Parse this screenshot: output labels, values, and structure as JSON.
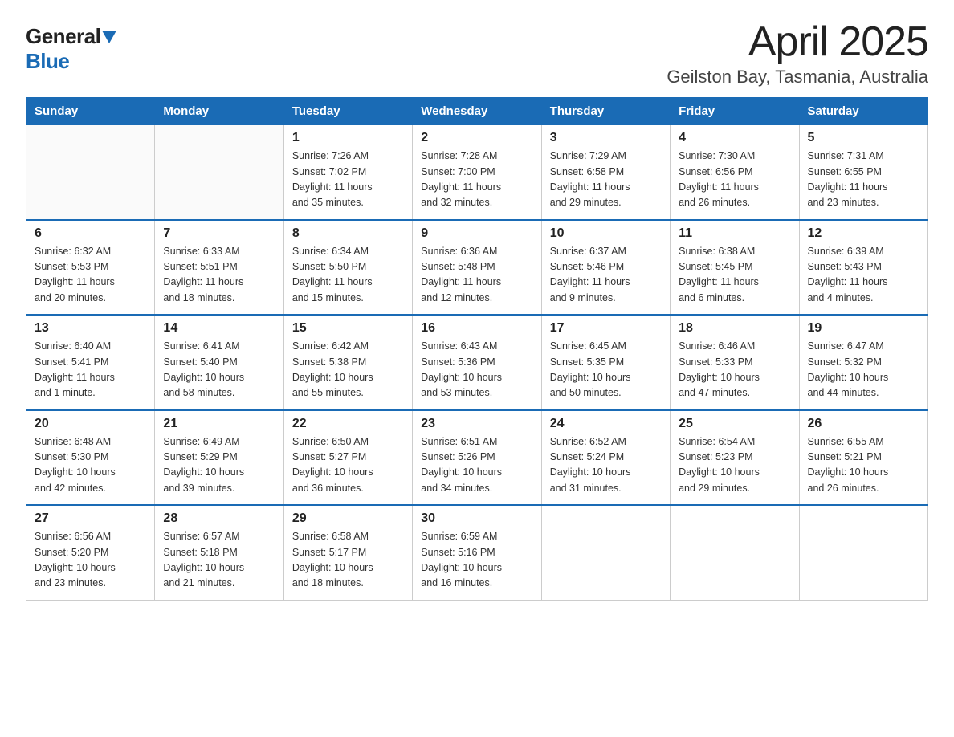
{
  "logo": {
    "general": "General",
    "blue": "Blue"
  },
  "title": "April 2025",
  "subtitle": "Geilston Bay, Tasmania, Australia",
  "weekdays": [
    "Sunday",
    "Monday",
    "Tuesday",
    "Wednesday",
    "Thursday",
    "Friday",
    "Saturday"
  ],
  "weeks": [
    [
      {
        "day": "",
        "info": ""
      },
      {
        "day": "",
        "info": ""
      },
      {
        "day": "1",
        "info": "Sunrise: 7:26 AM\nSunset: 7:02 PM\nDaylight: 11 hours\nand 35 minutes."
      },
      {
        "day": "2",
        "info": "Sunrise: 7:28 AM\nSunset: 7:00 PM\nDaylight: 11 hours\nand 32 minutes."
      },
      {
        "day": "3",
        "info": "Sunrise: 7:29 AM\nSunset: 6:58 PM\nDaylight: 11 hours\nand 29 minutes."
      },
      {
        "day": "4",
        "info": "Sunrise: 7:30 AM\nSunset: 6:56 PM\nDaylight: 11 hours\nand 26 minutes."
      },
      {
        "day": "5",
        "info": "Sunrise: 7:31 AM\nSunset: 6:55 PM\nDaylight: 11 hours\nand 23 minutes."
      }
    ],
    [
      {
        "day": "6",
        "info": "Sunrise: 6:32 AM\nSunset: 5:53 PM\nDaylight: 11 hours\nand 20 minutes."
      },
      {
        "day": "7",
        "info": "Sunrise: 6:33 AM\nSunset: 5:51 PM\nDaylight: 11 hours\nand 18 minutes."
      },
      {
        "day": "8",
        "info": "Sunrise: 6:34 AM\nSunset: 5:50 PM\nDaylight: 11 hours\nand 15 minutes."
      },
      {
        "day": "9",
        "info": "Sunrise: 6:36 AM\nSunset: 5:48 PM\nDaylight: 11 hours\nand 12 minutes."
      },
      {
        "day": "10",
        "info": "Sunrise: 6:37 AM\nSunset: 5:46 PM\nDaylight: 11 hours\nand 9 minutes."
      },
      {
        "day": "11",
        "info": "Sunrise: 6:38 AM\nSunset: 5:45 PM\nDaylight: 11 hours\nand 6 minutes."
      },
      {
        "day": "12",
        "info": "Sunrise: 6:39 AM\nSunset: 5:43 PM\nDaylight: 11 hours\nand 4 minutes."
      }
    ],
    [
      {
        "day": "13",
        "info": "Sunrise: 6:40 AM\nSunset: 5:41 PM\nDaylight: 11 hours\nand 1 minute."
      },
      {
        "day": "14",
        "info": "Sunrise: 6:41 AM\nSunset: 5:40 PM\nDaylight: 10 hours\nand 58 minutes."
      },
      {
        "day": "15",
        "info": "Sunrise: 6:42 AM\nSunset: 5:38 PM\nDaylight: 10 hours\nand 55 minutes."
      },
      {
        "day": "16",
        "info": "Sunrise: 6:43 AM\nSunset: 5:36 PM\nDaylight: 10 hours\nand 53 minutes."
      },
      {
        "day": "17",
        "info": "Sunrise: 6:45 AM\nSunset: 5:35 PM\nDaylight: 10 hours\nand 50 minutes."
      },
      {
        "day": "18",
        "info": "Sunrise: 6:46 AM\nSunset: 5:33 PM\nDaylight: 10 hours\nand 47 minutes."
      },
      {
        "day": "19",
        "info": "Sunrise: 6:47 AM\nSunset: 5:32 PM\nDaylight: 10 hours\nand 44 minutes."
      }
    ],
    [
      {
        "day": "20",
        "info": "Sunrise: 6:48 AM\nSunset: 5:30 PM\nDaylight: 10 hours\nand 42 minutes."
      },
      {
        "day": "21",
        "info": "Sunrise: 6:49 AM\nSunset: 5:29 PM\nDaylight: 10 hours\nand 39 minutes."
      },
      {
        "day": "22",
        "info": "Sunrise: 6:50 AM\nSunset: 5:27 PM\nDaylight: 10 hours\nand 36 minutes."
      },
      {
        "day": "23",
        "info": "Sunrise: 6:51 AM\nSunset: 5:26 PM\nDaylight: 10 hours\nand 34 minutes."
      },
      {
        "day": "24",
        "info": "Sunrise: 6:52 AM\nSunset: 5:24 PM\nDaylight: 10 hours\nand 31 minutes."
      },
      {
        "day": "25",
        "info": "Sunrise: 6:54 AM\nSunset: 5:23 PM\nDaylight: 10 hours\nand 29 minutes."
      },
      {
        "day": "26",
        "info": "Sunrise: 6:55 AM\nSunset: 5:21 PM\nDaylight: 10 hours\nand 26 minutes."
      }
    ],
    [
      {
        "day": "27",
        "info": "Sunrise: 6:56 AM\nSunset: 5:20 PM\nDaylight: 10 hours\nand 23 minutes."
      },
      {
        "day": "28",
        "info": "Sunrise: 6:57 AM\nSunset: 5:18 PM\nDaylight: 10 hours\nand 21 minutes."
      },
      {
        "day": "29",
        "info": "Sunrise: 6:58 AM\nSunset: 5:17 PM\nDaylight: 10 hours\nand 18 minutes."
      },
      {
        "day": "30",
        "info": "Sunrise: 6:59 AM\nSunset: 5:16 PM\nDaylight: 10 hours\nand 16 minutes."
      },
      {
        "day": "",
        "info": ""
      },
      {
        "day": "",
        "info": ""
      },
      {
        "day": "",
        "info": ""
      }
    ]
  ]
}
